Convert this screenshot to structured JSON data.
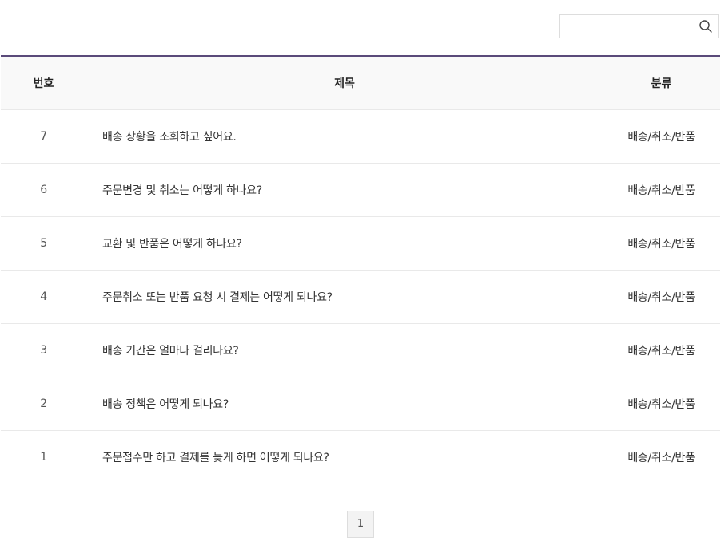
{
  "search": {
    "value": "",
    "placeholder": "",
    "icon": "search-icon"
  },
  "table": {
    "headers": {
      "no": "번호",
      "title": "제목",
      "category": "분류"
    },
    "rows": [
      {
        "no": "7",
        "title": "배송 상황을 조회하고 싶어요.",
        "category": "배송/취소/반품"
      },
      {
        "no": "6",
        "title": "주문변경 및 취소는 어떻게 하나요?",
        "category": "배송/취소/반품"
      },
      {
        "no": "5",
        "title": "교환 및 반품은 어떻게 하나요?",
        "category": "배송/취소/반품"
      },
      {
        "no": "4",
        "title": "주문취소 또는 반품 요청 시 결제는 어떻게 되나요?",
        "category": "배송/취소/반품"
      },
      {
        "no": "3",
        "title": "배송 기간은 얼마나 걸리나요?",
        "category": "배송/취소/반품"
      },
      {
        "no": "2",
        "title": "배송 정책은 어떻게 되나요?",
        "category": "배송/취소/반품"
      },
      {
        "no": "1",
        "title": "주문접수만 하고 결제를 늦게 하면 어떻게 되나요?",
        "category": "배송/취소/반품"
      }
    ]
  },
  "pagination": {
    "current": "1"
  },
  "colors": {
    "header_border": "#5a4a7a",
    "header_bg": "#f9f9f9",
    "row_divider": "#e9e9e9"
  }
}
